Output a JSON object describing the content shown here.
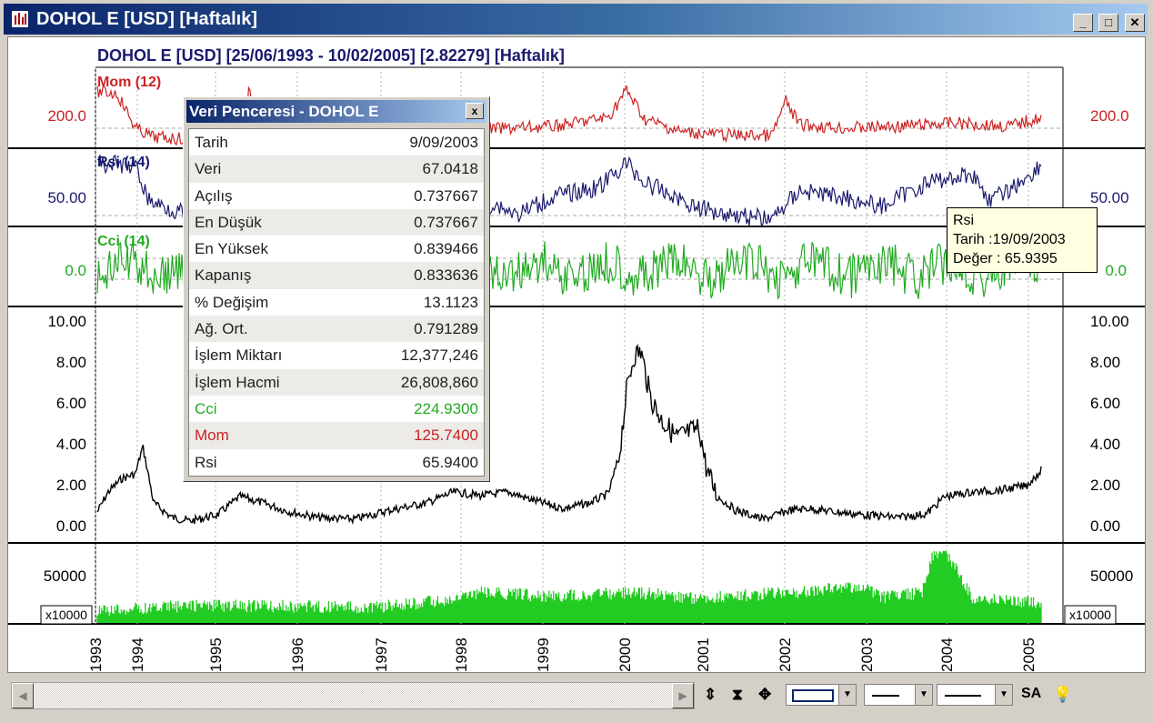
{
  "window": {
    "title": "DOHOL E [USD] [Haftalık]",
    "buttons": {
      "minimize": "_",
      "maximize": "□",
      "close": "✕"
    }
  },
  "chart": {
    "header": "DOHOL E  [USD]  [25/06/1993 - 10/02/2005]  [2.82279]  [Haftalık]",
    "panels": {
      "mom": {
        "label": "Mom (12)",
        "tick": "200.0",
        "color": "#cc2222"
      },
      "rsi": {
        "label": "Rsi (14)",
        "tick": "50.00",
        "color": "#1a1a6e"
      },
      "cci": {
        "label": "Cci (14)",
        "tick": "0.0",
        "color": "#22aa22"
      },
      "price": {
        "ticks_left": [
          "10.00",
          "8.00",
          "6.00",
          "4.00",
          "2.00",
          "0.00"
        ],
        "color": "#000000"
      },
      "volume": {
        "tick": "50000",
        "multiplier": "x10000",
        "color": "#22cc22"
      }
    },
    "years": [
      "1993",
      "1994",
      "1995",
      "1996",
      "1997",
      "1998",
      "1999",
      "2000",
      "2001",
      "2002",
      "2003",
      "2004",
      "2005"
    ]
  },
  "data_window": {
    "title": "Veri Penceresi - DOHOL E",
    "close": "x",
    "rows": [
      {
        "k": "Tarih",
        "v": "9/09/2003",
        "color": "#202020"
      },
      {
        "k": "Veri",
        "v": "67.0418",
        "color": "#202020"
      },
      {
        "k": "Açılış",
        "v": "0.737667",
        "color": "#202020"
      },
      {
        "k": "En Düşük",
        "v": "0.737667",
        "color": "#202020"
      },
      {
        "k": "En Yüksek",
        "v": "0.839466",
        "color": "#202020"
      },
      {
        "k": "Kapanış",
        "v": "0.833636",
        "color": "#202020"
      },
      {
        "k": "% Değişim",
        "v": "13.1123",
        "color": "#202020"
      },
      {
        "k": "Ağ. Ort.",
        "v": "0.791289",
        "color": "#202020"
      },
      {
        "k": "İşlem Miktarı",
        "v": "12,377,246",
        "color": "#202020"
      },
      {
        "k": "İşlem Hacmi",
        "v": "26,808,860",
        "color": "#202020"
      },
      {
        "k": "Cci",
        "v": "224.9300",
        "color": "#22aa22"
      },
      {
        "k": "Mom",
        "v": "125.7400",
        "color": "#cc2222"
      },
      {
        "k": "Rsi",
        "v": "65.9400",
        "color": "#202020"
      }
    ]
  },
  "tooltip": {
    "name": "Rsi",
    "date_line": "Tarih   :19/09/2003",
    "value_line": "Değer : 65.9395"
  },
  "toolbar": {
    "sa_label": "SA"
  }
}
